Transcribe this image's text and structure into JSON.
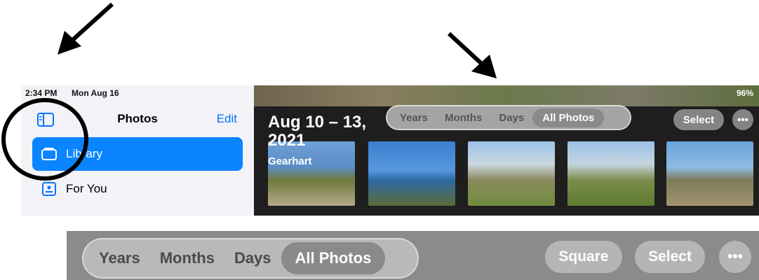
{
  "status": {
    "time": "2:34 PM",
    "date": "Mon Aug 16",
    "battery": "96%"
  },
  "sidebar": {
    "title": "Photos",
    "edit_label": "Edit",
    "items": [
      {
        "label": "Library"
      },
      {
        "label": "For You"
      }
    ]
  },
  "photos": {
    "date_range": "Aug 10 – 13, 2021",
    "place": "Gearhart",
    "tabs": [
      "Years",
      "Months",
      "Days",
      "All Photos"
    ],
    "selected_tab": "All Photos",
    "select_label": "Select"
  },
  "zoomed_toolbar": {
    "tabs": [
      "Years",
      "Months",
      "Days",
      "All Photos"
    ],
    "selected_tab": "All Photos",
    "square_label": "Square",
    "select_label": "Select"
  },
  "colors": {
    "accent": "#0a84ff",
    "sidebar_bg": "#f2f2f7"
  }
}
